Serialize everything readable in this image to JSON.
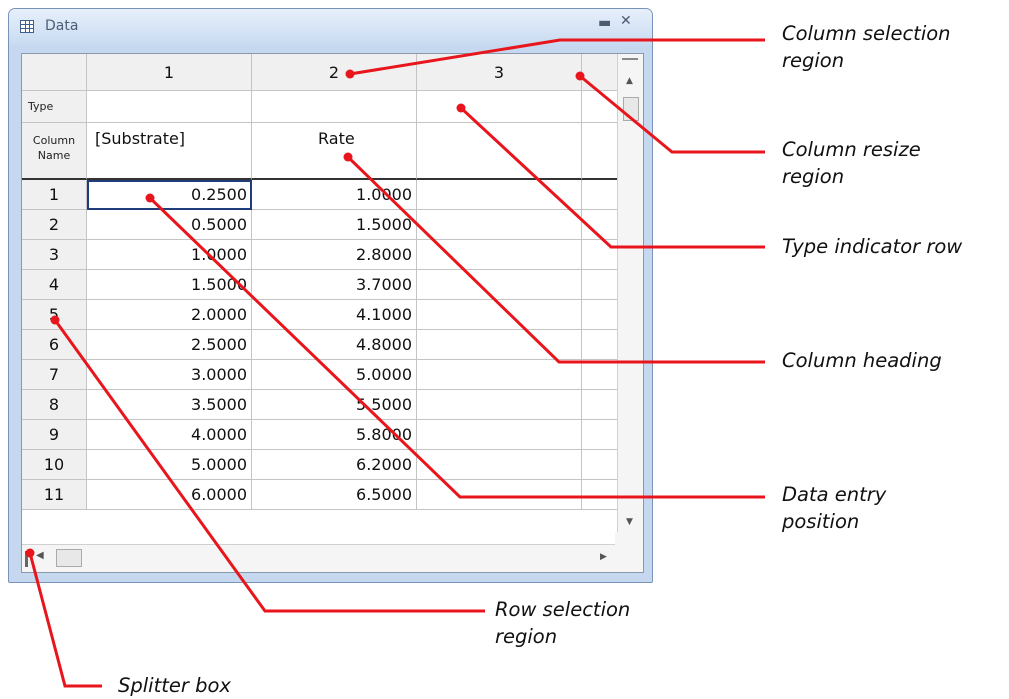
{
  "window": {
    "title": "Data"
  },
  "grid": {
    "column_numbers": [
      "1",
      "2",
      "3"
    ],
    "type_label": "Type",
    "column_name_label": "Column\nName",
    "column_names": [
      "[Substrate]",
      "Rate",
      ""
    ],
    "rows": [
      {
        "n": "1",
        "c1": "0.2500",
        "c2": "1.0000"
      },
      {
        "n": "2",
        "c1": "0.5000",
        "c2": "1.5000"
      },
      {
        "n": "3",
        "c1": "1.0000",
        "c2": "2.8000"
      },
      {
        "n": "4",
        "c1": "1.5000",
        "c2": "3.7000"
      },
      {
        "n": "5",
        "c1": "2.0000",
        "c2": "4.1000"
      },
      {
        "n": "6",
        "c1": "2.5000",
        "c2": "4.8000"
      },
      {
        "n": "7",
        "c1": "3.0000",
        "c2": "5.0000"
      },
      {
        "n": "8",
        "c1": "3.5000",
        "c2": "5.5000"
      },
      {
        "n": "9",
        "c1": "4.0000",
        "c2": "5.8000"
      },
      {
        "n": "10",
        "c1": "5.0000",
        "c2": "6.2000"
      },
      {
        "n": "11",
        "c1": "6.0000",
        "c2": "6.5000"
      }
    ]
  },
  "callouts": {
    "column_selection": "Column selection\nregion",
    "column_resize": "Column resize\nregion",
    "type_indicator": "Type indicator row",
    "column_heading": "Column heading",
    "data_entry": "Data entry\nposition",
    "row_selection": "Row selection\nregion",
    "splitter": "Splitter box"
  },
  "colors": {
    "leader": "#e8161c",
    "selection_border": "#1f3d7a"
  }
}
